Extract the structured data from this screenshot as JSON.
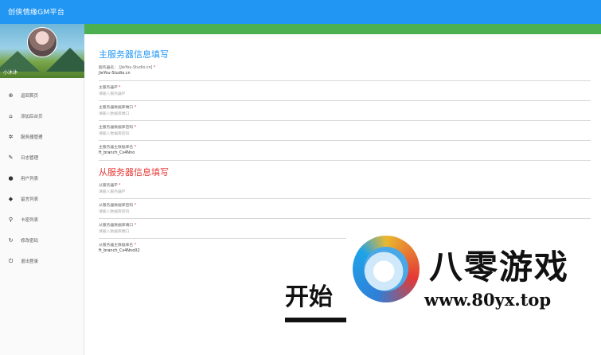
{
  "app": {
    "title": "创侠情缘GM平台"
  },
  "user": {
    "name": "小沐沐"
  },
  "sidebar": {
    "items": [
      {
        "label": "返回首页",
        "icon": "plus-circle-icon",
        "glyph": "⊕"
      },
      {
        "label": "添加后台页",
        "icon": "home-icon",
        "glyph": "⌂"
      },
      {
        "label": "服务器管理",
        "icon": "gear-icon",
        "glyph": "✲"
      },
      {
        "label": "日志管理",
        "icon": "edit-icon",
        "glyph": "✎"
      },
      {
        "label": "用户列表",
        "icon": "user-icon",
        "glyph": "●"
      },
      {
        "label": "留言列表",
        "icon": "chat-icon",
        "glyph": "◆"
      },
      {
        "label": "卡密列表",
        "icon": "key-icon",
        "glyph": "⚲"
      },
      {
        "label": "修改密码",
        "icon": "refresh-icon",
        "glyph": "↻"
      },
      {
        "label": "退出登录",
        "icon": "power-icon",
        "glyph": "⏻"
      }
    ]
  },
  "form": {
    "main_section_title": "主服务器信息填写",
    "slave_section_title": "从服务器信息填写",
    "main_fields": [
      {
        "label": "服务器名",
        "hint": "[JieYou-Studio.cn]",
        "required": true,
        "value": "JieYou-Studio.cn",
        "placeholder": ""
      },
      {
        "label": "主服务器IP",
        "hint": "",
        "required": true,
        "value": "",
        "placeholder": "请输入服务器IP"
      },
      {
        "label": "主服务器数据库端口",
        "hint": "",
        "required": true,
        "value": "",
        "placeholder": "请输入数据库端口"
      },
      {
        "label": "主服务器数据库密码",
        "hint": "",
        "required": true,
        "value": "",
        "placeholder": "请输入数据库密码"
      },
      {
        "label": "主服务器主数据库名",
        "hint": "",
        "required": true,
        "value": "ft_branch_Cs4Nno",
        "placeholder": ""
      }
    ],
    "slave_fields": [
      {
        "label": "从服务器IP",
        "required": true,
        "value": "",
        "placeholder": "请输入服务器IP"
      },
      {
        "label": "从服务器数据库密码",
        "required": true,
        "value": "",
        "placeholder": "请输入数据库密码"
      },
      {
        "label": "从服务器数据库端口",
        "required": true,
        "value": "",
        "placeholder": "请输入数据库端口"
      },
      {
        "label": "从服务器主数据库名",
        "required": true,
        "value": "ft_branch_Cs4Nno02",
        "placeholder": ""
      }
    ],
    "start_button": "开始"
  },
  "watermark": {
    "brand": "八零游戏",
    "url": "www.80yx.top"
  },
  "colors": {
    "topbar": "#2196f3",
    "greenbar": "#4caf50",
    "main_title": "#2196f3",
    "slave_title": "#e53935"
  }
}
